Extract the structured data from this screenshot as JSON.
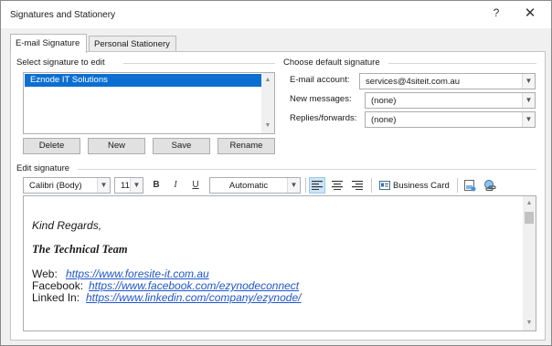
{
  "window": {
    "title": "Signatures and Stationery",
    "help_glyph": "?",
    "close_glyph": "✕"
  },
  "tabs": [
    {
      "label": "E-mail Signature",
      "active": true
    },
    {
      "label": "Personal Stationery",
      "active": false
    }
  ],
  "select_section": {
    "label": "Select signature to edit",
    "items": [
      "Eznode IT Solutions"
    ],
    "selected": "Eznode IT Solutions"
  },
  "buttons": {
    "delete": "Delete",
    "new": "New",
    "save": "Save",
    "rename": "Rename",
    "business_card": "Business Card"
  },
  "default_section": {
    "label": "Choose default signature",
    "email_account_label": "E-mail account:",
    "email_account_value": "services@4siteit.com.au",
    "new_messages_label": "New messages:",
    "new_messages_value": "(none)",
    "replies_label": "Replies/forwards:",
    "replies_value": "(none)"
  },
  "edit_section": {
    "label": "Edit signature",
    "font_name": "Calibri (Body)",
    "font_size": "11",
    "bold": "B",
    "italic": "I",
    "underline": "U",
    "color": "Automatic",
    "align_left_active": true
  },
  "signature": {
    "line1": "Kind Regards,",
    "line2": "The Technical Team",
    "web_label": "Web:",
    "web_link": "https://www.foresite-it.com.au",
    "facebook_label": "Facebook:",
    "facebook_link": "https://www.facebook.com/ezynodeconnect",
    "linkedin_label": "Linked In:",
    "linkedin_link": "https://www.linkedin.com/company/ezynode/"
  },
  "colors": {
    "selection": "#0b6fd1",
    "link": "#1f56c9"
  }
}
